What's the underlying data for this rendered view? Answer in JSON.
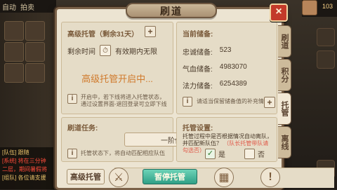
{
  "hud": {
    "top_left_label": "自动",
    "top_left_label_2": "拍卖",
    "level": "103"
  },
  "left_chat": {
    "lines": [
      {
        "text": "[队伍] 跟随",
        "tone": "yellow"
      },
      {
        "text": "[系统] 将在三分钟",
        "tone": "red"
      },
      {
        "text": "二层，期间暑假将",
        "tone": "red"
      },
      {
        "text": "[组队] 各位请支援",
        "tone": "yellow"
      }
    ]
  },
  "dialog": {
    "title": "刷道",
    "close_label": "×",
    "tabs": [
      {
        "label": "刷道",
        "active": false
      },
      {
        "label": "积分",
        "active": false
      },
      {
        "label": "托管",
        "active": true
      },
      {
        "label": "离线",
        "active": false
      }
    ],
    "advanced": {
      "title": "高级托管（剩余31天）",
      "remaining_label": "剩余时间",
      "remaining_value": "有效期内无限",
      "status": "高级托管开启中...",
      "note": "开启中，若下线将进入托管状态，通过设置界面-退回登录可立即下线"
    },
    "reserves": {
      "title": "当前储备:",
      "rows": [
        {
          "label": "忠诚储备:",
          "value": "523"
        },
        {
          "label": "气血储备:",
          "value": "4983070"
        },
        {
          "label": "法力储备:",
          "value": "6254389"
        }
      ],
      "note": "请适当保留储备值的补充情况"
    },
    "task": {
      "title": "刷道任务:",
      "selected": "一阶伏魔",
      "note": "托管状态下，将自动匹配相应队伍"
    },
    "settings": {
      "title": "托管设置:",
      "desc": "托管过程中是否根据情况自动离队，并匹配新队伍？",
      "desc_highlight": "（队长托管带队请勾选否）",
      "yes_label": "是",
      "no_label": "否",
      "yes_checked": true,
      "no_checked": false
    },
    "bottom": {
      "advanced_btn": "高级托管",
      "pause_btn": "暂停托管"
    }
  },
  "colors": {
    "panel_bg": "#ece4d2",
    "panel_border": "#7a6148",
    "title_text": "#3b2a1a",
    "orange_text": "#d07a2c",
    "red_close": "#c33a2a",
    "green_button": "#2f9f86"
  },
  "icons": {
    "plus": "plus-icon",
    "clock": "clock-icon",
    "info": "info-icon",
    "down": "chevron-down-icon",
    "close": "close-icon",
    "swords": "swords-icon",
    "stack": "stack-icon",
    "alert": "alert-icon"
  }
}
